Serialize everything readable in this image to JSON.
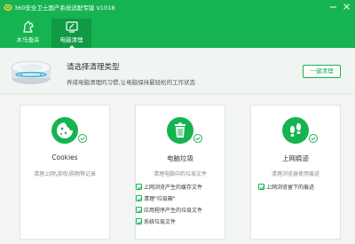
{
  "app": {
    "title": "360安全卫士国产系统适配专版 V1018"
  },
  "nav": {
    "tabs": [
      {
        "label": "木马查杀"
      },
      {
        "label": "电脑清理"
      }
    ]
  },
  "banner": {
    "title": "请选择清理类型",
    "subtitle": "养成电脑清理的习惯,让电脑保持最轻松的工作状态",
    "button_label": "一键清理"
  },
  "cards": [
    {
      "title": "Cookies",
      "desc": "清理上网\\游戏\\购物等记录",
      "options": []
    },
    {
      "title": "电脑垃圾",
      "desc": "清理电脑中的垃圾文件",
      "options": [
        {
          "label": "上网浏览产生的缓存文件",
          "checked": true
        },
        {
          "label": "清理\"垃圾箱\"",
          "checked": true
        },
        {
          "label": "应用程序产生的垃圾文件",
          "checked": true
        },
        {
          "label": "系统垃圾文件",
          "checked": true
        }
      ]
    },
    {
      "title": "上网痕迹",
      "desc": "清理浏览器使用痕迹",
      "options": [
        {
          "label": "上网浏览留下的痕迹",
          "checked": true
        }
      ]
    }
  ],
  "colors": {
    "brand_green": "#16b451",
    "tab_active": "#0f9a43",
    "card_border": "#dfe5e1"
  },
  "icons": {
    "logo": "360-shield-icon",
    "minimize": "minimize-icon",
    "close": "close-icon",
    "tab_horse": "horse-icon",
    "tab_clean": "broom-icon",
    "cookies": "cookie-icon",
    "junk": "trash-can-icon",
    "trace": "footprints-icon",
    "checked": "checked-circle-icon"
  }
}
